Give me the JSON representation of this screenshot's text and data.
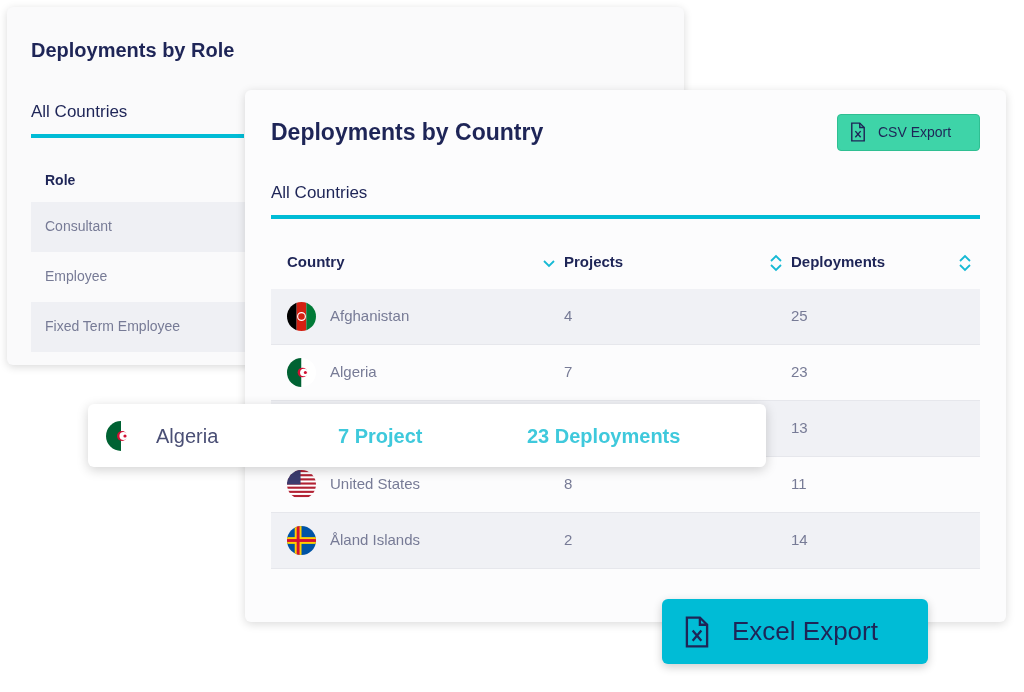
{
  "role_card": {
    "title": "Deployments by Role",
    "tab": {
      "label": "All Countries",
      "selected": true
    },
    "columns": [
      "Role"
    ],
    "rows": [
      "Consultant",
      "Employee",
      "Fixed Term Employee"
    ]
  },
  "country_card": {
    "title": "Deployments by Country",
    "export_button": "CSV Export",
    "tab": {
      "label": "All Countries",
      "selected": true
    },
    "columns": [
      {
        "label": "Country",
        "kind": "desc"
      },
      {
        "label": "Projects",
        "kind": "both"
      },
      {
        "label": "Deployments",
        "kind": "both"
      }
    ],
    "rows": [
      {
        "kind": "af",
        "country": "Afghanistan",
        "projects": "4",
        "deployments": "25"
      },
      {
        "kind": "dz",
        "country": "Algeria",
        "projects": "7",
        "deployments": "23"
      },
      {
        "deployments": "13"
      },
      {
        "kind": "us",
        "country": "United States",
        "projects": "8",
        "deployments": "11"
      },
      {
        "kind": "ax",
        "country": "Åland Islands",
        "projects": "2",
        "deployments": "14"
      }
    ]
  },
  "tooltip": {
    "kind": "dz",
    "country": "Algeria",
    "projects": "7 Project",
    "deployments": "23 Deployments"
  },
  "excel_button": "Excel Export"
}
